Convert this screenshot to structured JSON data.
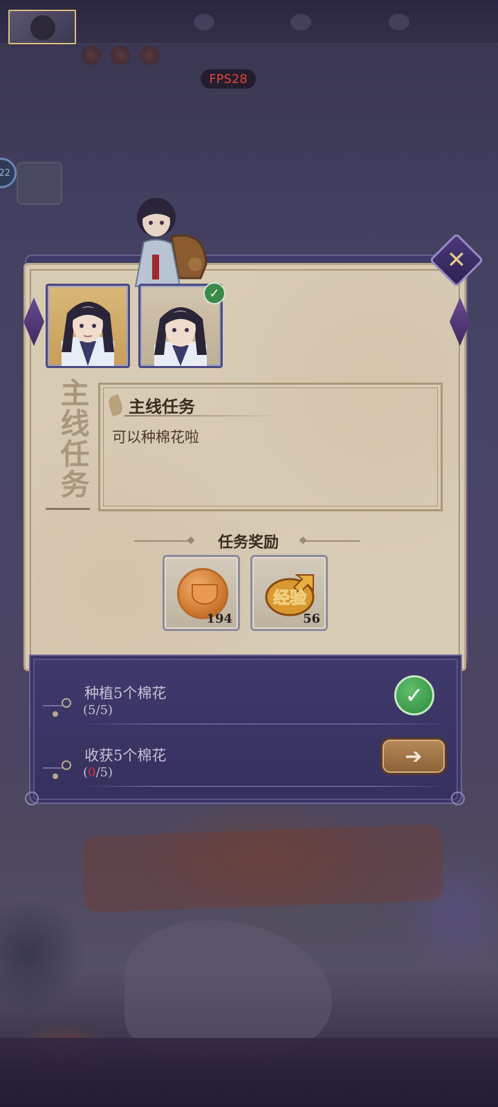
{
  "hud": {
    "fps": "FPS28",
    "side_badge": "22"
  },
  "dialog": {
    "vertical_title": "主线任务",
    "description_title": "主线任务",
    "description_text": "可以种棉花啦",
    "reward_title": "任务奖励",
    "close_icon": "close-icon",
    "rewards": [
      {
        "icon": "coin-icon",
        "count": "194"
      },
      {
        "icon": "exp-icon",
        "label": "经验",
        "count": "56"
      }
    ],
    "objectives": [
      {
        "name": "种植5个棉花",
        "progress_open": "(",
        "progress_current": "5",
        "progress_rest": "/5)",
        "status": "done",
        "status_icon": "check-icon"
      },
      {
        "name": "收获5个棉花",
        "progress_open": "(",
        "progress_current": "0",
        "progress_rest": "/5)",
        "status": "go",
        "status_icon": "arrow-right-icon",
        "current_color": "#d83030"
      }
    ]
  }
}
